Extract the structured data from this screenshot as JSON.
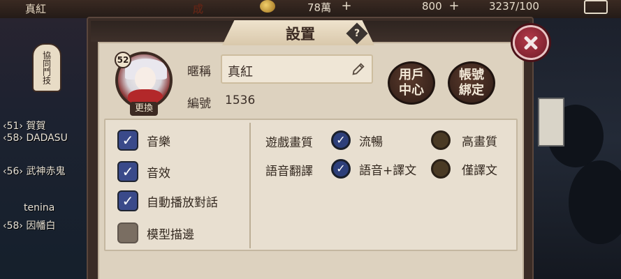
{
  "topbar": {
    "player_name": "真紅",
    "title_fragment": "成",
    "resource_1": "78萬",
    "resource_2": "800",
    "resource_3": "3237/100"
  },
  "background": {
    "left_badge": "協同鬥技",
    "chat": [
      {
        "text": "‹51›  賀賀"
      },
      {
        "text": "‹58›  DADASU"
      },
      {
        "text": "‹56›  武神赤鬼"
      },
      {
        "text": "tenina"
      },
      {
        "text": "‹58›  因幡白"
      }
    ]
  },
  "dialog": {
    "title": "設置",
    "help": "?"
  },
  "profile": {
    "level": "52",
    "change_label": "更換",
    "nickname_label": "暱稱",
    "nickname_value": "真紅",
    "id_label": "編號",
    "id_value": "1536"
  },
  "actions": {
    "user_center": "用戶中心",
    "bind_account": "帳號綁定"
  },
  "toggles": [
    {
      "label": "音樂",
      "checked": true
    },
    {
      "label": "音效",
      "checked": true
    },
    {
      "label": "自動播放對話",
      "checked": true
    },
    {
      "label": "模型描邊",
      "checked": false
    }
  ],
  "quality": {
    "label": "遊戲畫質",
    "options": [
      {
        "label": "流暢",
        "selected": true
      },
      {
        "label": "高畫質",
        "selected": false
      }
    ]
  },
  "voice": {
    "label": "語音翻譯",
    "options": [
      {
        "label": "語音+譯文",
        "selected": true
      },
      {
        "label": "僅譯文",
        "selected": false
      }
    ]
  },
  "colors": {
    "checkbox_on": "#3a4a8a",
    "checkbox_off": "#7a6e62",
    "panel": "#ddd2bf",
    "close": "#b43a4a"
  }
}
